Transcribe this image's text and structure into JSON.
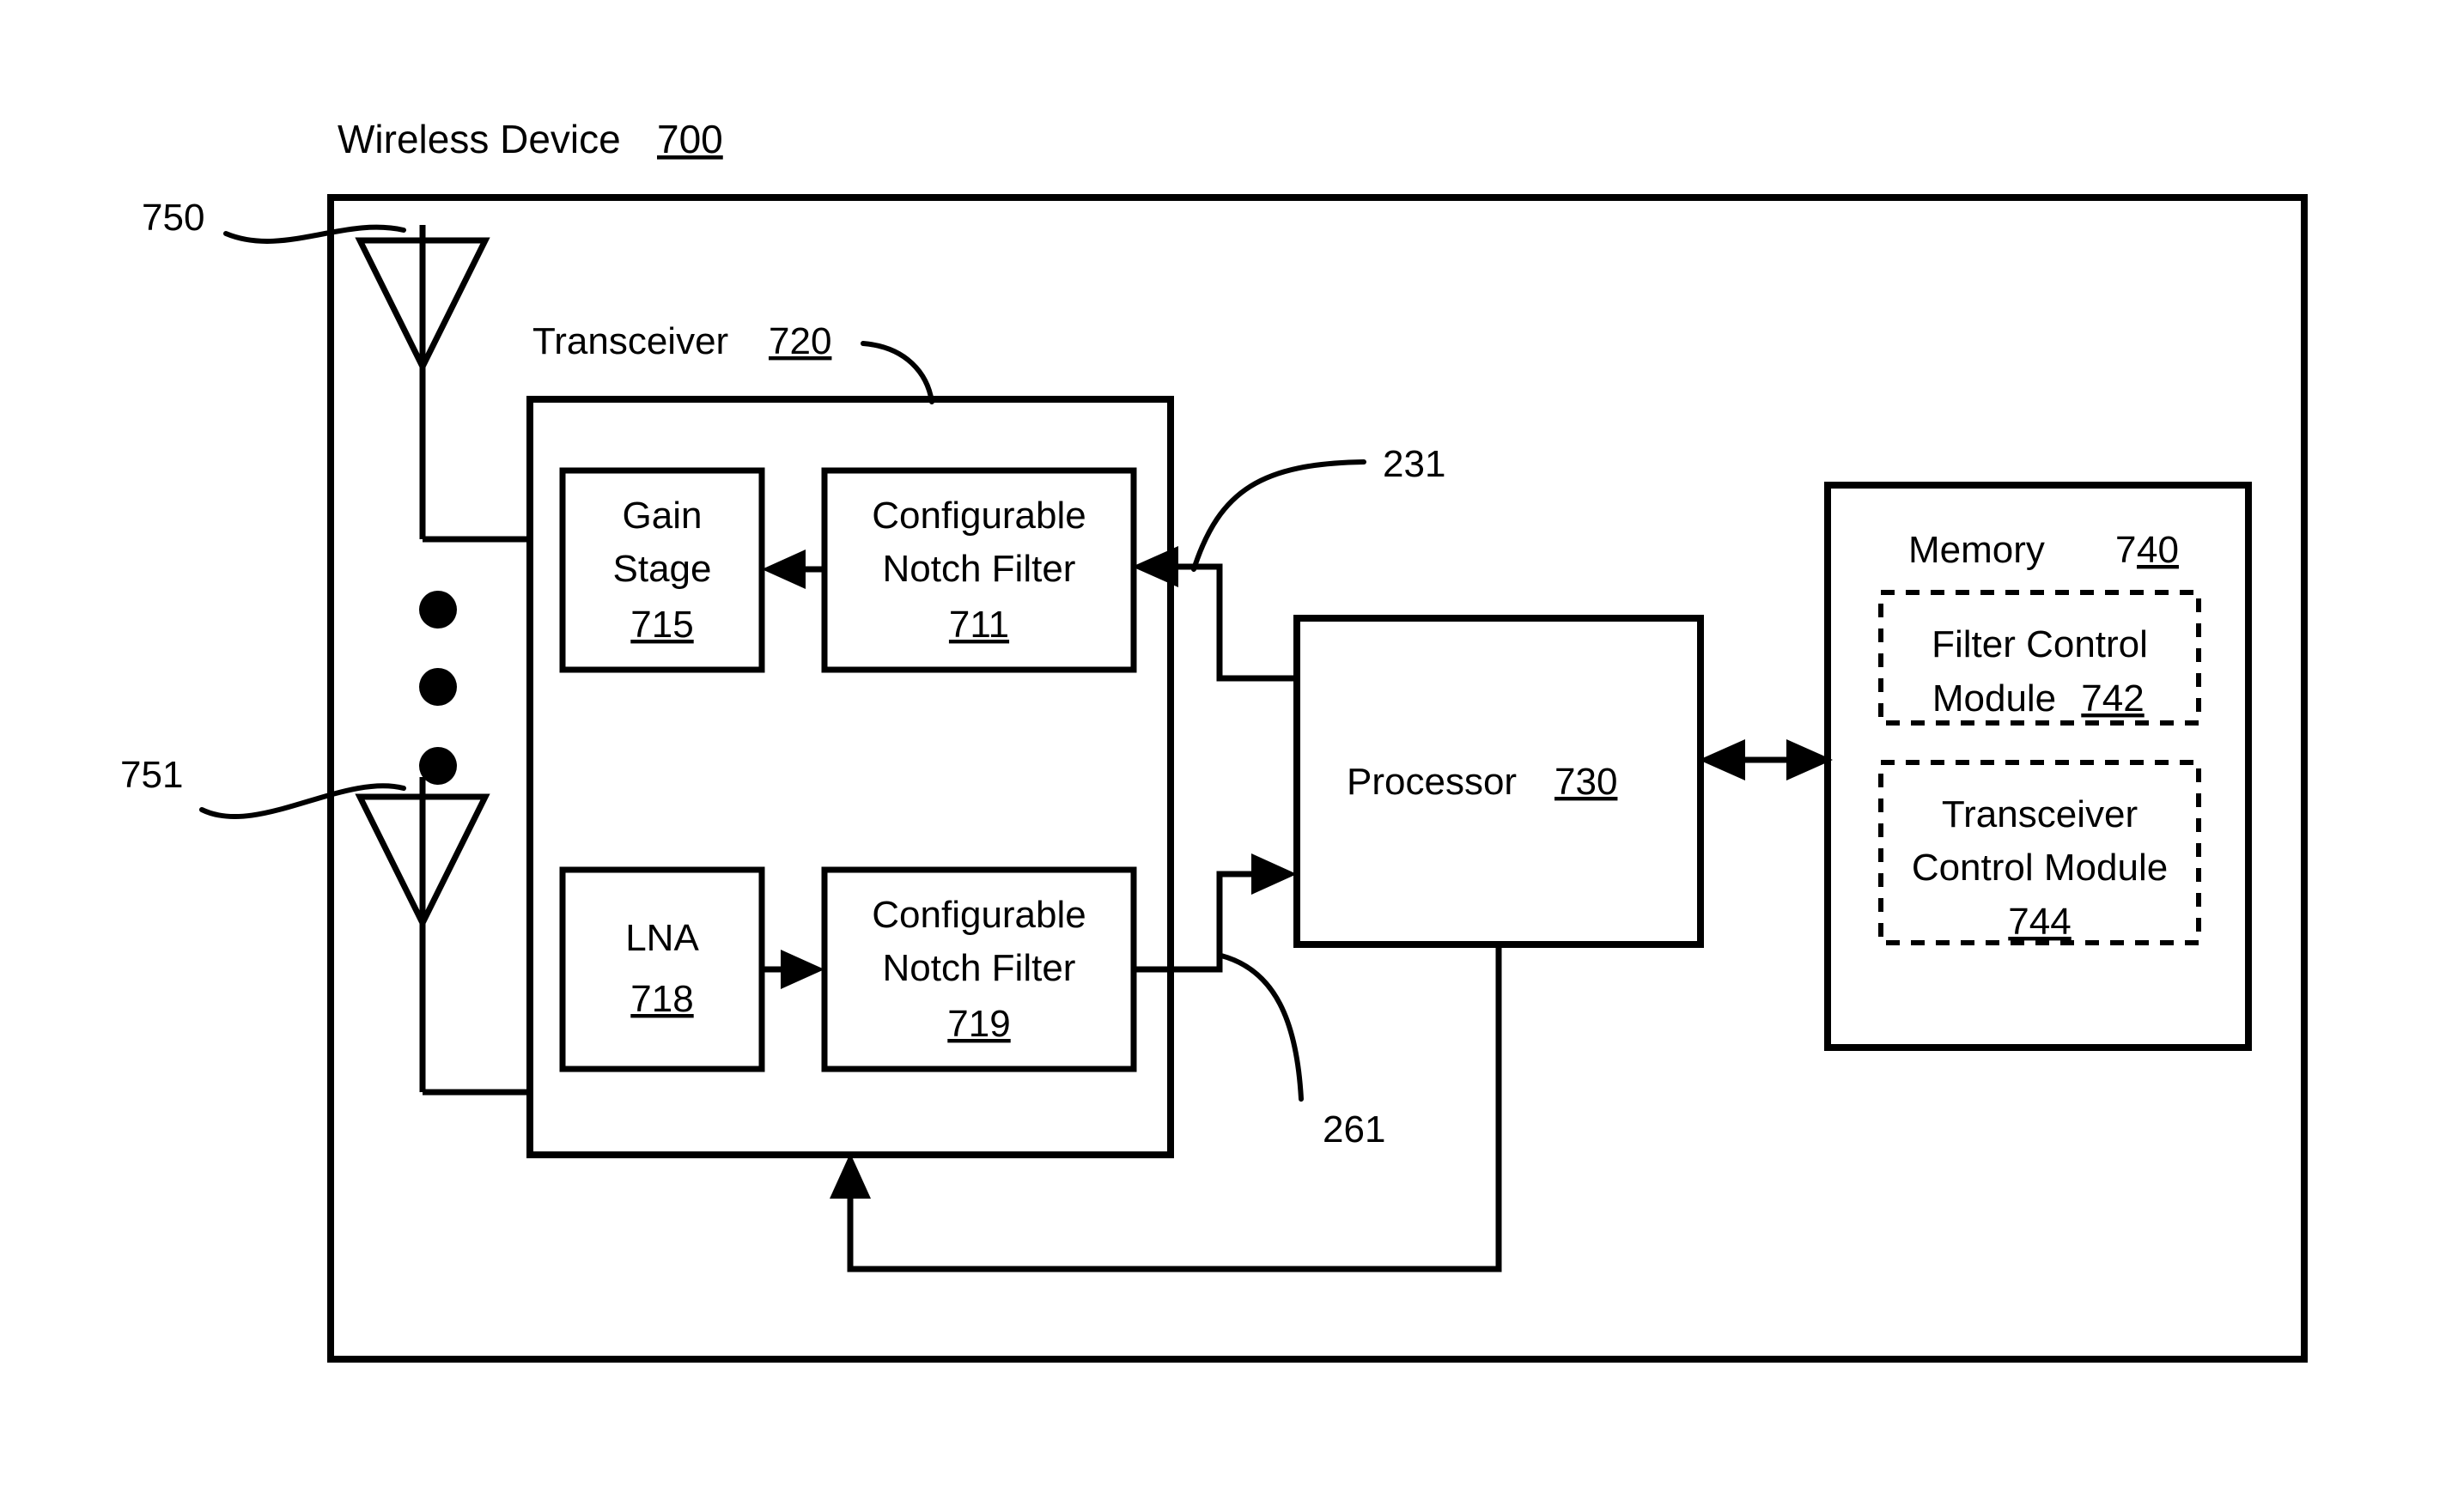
{
  "figure": {
    "title_text": "Wireless Device",
    "title_ref": "700"
  },
  "labels": {
    "antenna_top_ref": "750",
    "antenna_bottom_ref": "751",
    "signal_path_top_ref": "231",
    "signal_path_bottom_ref": "261"
  },
  "transceiver": {
    "label_text": "Transceiver",
    "label_ref": "720",
    "blocks": {
      "gain_stage": {
        "line1": "Gain",
        "line2": "Stage",
        "ref": "715"
      },
      "notch_filter_top": {
        "line1": "Configurable",
        "line2": "Notch Filter",
        "ref": "711"
      },
      "lna": {
        "line1": "LNA",
        "ref": "718"
      },
      "notch_filter_bottom": {
        "line1": "Configurable",
        "line2": "Notch Filter",
        "ref": "719"
      }
    }
  },
  "processor": {
    "label_text": "Processor",
    "label_ref": "730"
  },
  "memory": {
    "label_text": "Memory",
    "label_ref_head": "7",
    "label_ref_tail": "40",
    "modules": {
      "filter_control": {
        "line1": "Filter Control",
        "line2_text": "Module",
        "line2_ref": "742"
      },
      "transceiver_control": {
        "line1": "Transceiver",
        "line2": "Control Module",
        "ref": "744"
      }
    }
  },
  "colors": {
    "ink": "#000000",
    "paper": "#ffffff"
  }
}
